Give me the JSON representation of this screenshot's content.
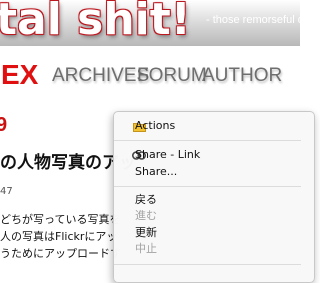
{
  "header": {
    "site_title": "tal shit!",
    "tagline": "- those remorseful days"
  },
  "nav": {
    "current": "EX",
    "links": [
      "ARCHIVES",
      "FORUM",
      "AUTHOR"
    ]
  },
  "post": {
    "red_fragment": "9",
    "heading": "の人物写真のアッ",
    "date": "47",
    "lines": [
      "どちが写っている写真を",
      "人の写真はFlickrにアッ",
      "うためにアップロードす"
    ]
  },
  "context_menu": {
    "items": [
      {
        "label": "Actions",
        "icon": "folder-icon",
        "enabled": true
      },
      {
        "label": "Share - Link",
        "icon": "link-icon",
        "enabled": true
      },
      {
        "label": "Share...",
        "icon": "",
        "enabled": true
      },
      {
        "label": "戻る",
        "icon": "",
        "enabled": true
      },
      {
        "label": "進む",
        "icon": "",
        "enabled": false
      },
      {
        "label": "更新",
        "icon": "",
        "enabled": true
      },
      {
        "label": "中止",
        "icon": "",
        "enabled": false
      }
    ]
  },
  "colors": {
    "accent_red": "#e01010",
    "nav_gray": "#6e6e6e",
    "folder_yellow": "#f2c232",
    "disabled_text": "#a3a3a3"
  }
}
